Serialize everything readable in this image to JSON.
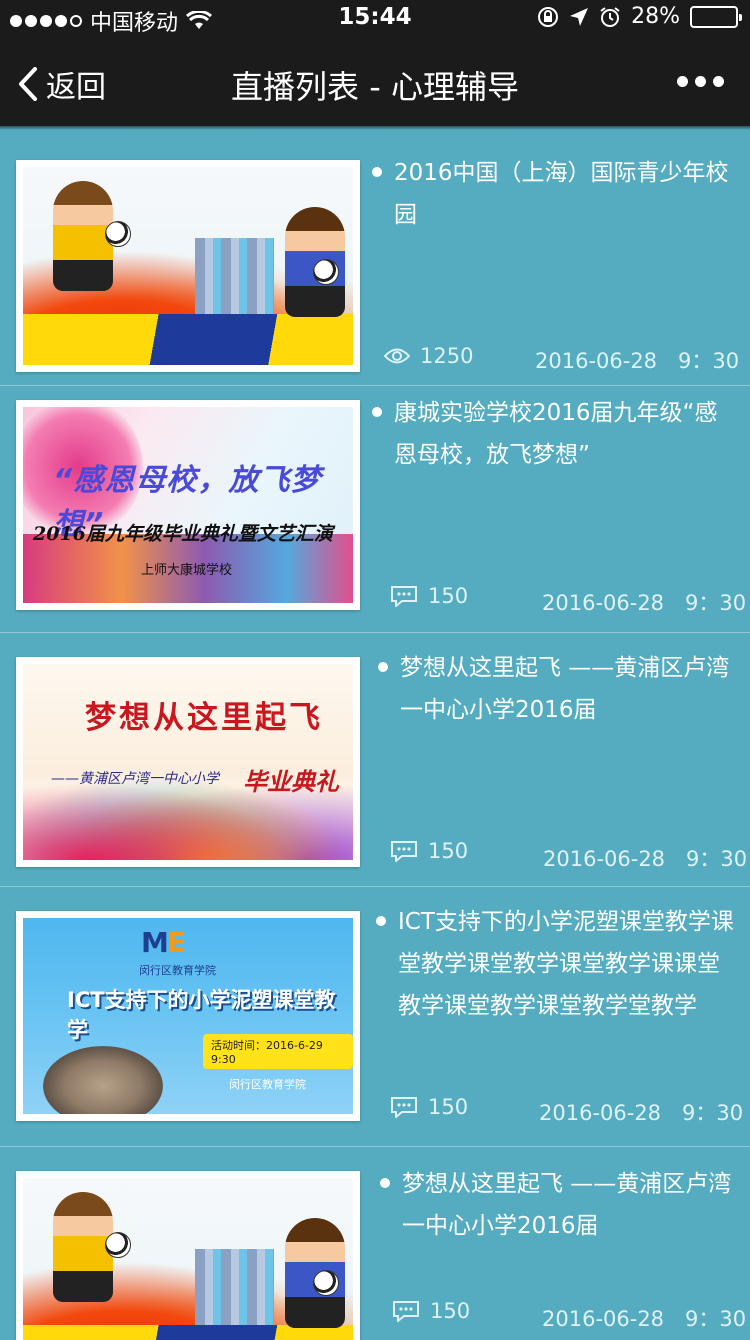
{
  "status_bar": {
    "carrier": "中国移动",
    "time": "15:44",
    "battery": "28%",
    "battery_level": 0.28
  },
  "nav": {
    "back_label": "返回",
    "title": "直播列表 - 心理辅导"
  },
  "items": [
    {
      "title": "2016中国（上海）国际青少年校园",
      "count": "1250",
      "count_icon": "eye-icon",
      "date": "2016-06-28　9：30"
    },
    {
      "title": "康城实验学校2016届九年级“感恩母校，放飞梦想”",
      "count": "150",
      "count_icon": "comment-icon",
      "date": "2016-06-28　9：30",
      "image_text": [
        "“感恩母校，放飞梦想”",
        "2016届九年级毕业典礼暨文艺汇演",
        "上师大康城学校"
      ]
    },
    {
      "title": "梦想从这里起飞 ——黄浦区卢湾一中心小学2016届",
      "count": "150",
      "count_icon": "comment-icon",
      "date": "2016-06-28　9：30",
      "image_text": [
        "梦想从这里起飞",
        "——黄浦区卢湾一中心小学",
        "毕业典礼"
      ]
    },
    {
      "title": "ICT支持下的小学泥塑课堂教学课堂教学课堂教学课堂教学课课堂教学课堂教学课堂教学堂教学",
      "count": "150",
      "count_icon": "comment-icon",
      "date": "2016-06-28　9：30",
      "image_text": [
        "闵行区教育学院",
        "ICT支持下的小学泥塑课堂教学",
        "活动时间：2016-6-29 9:30",
        "闵行区教育学院"
      ]
    },
    {
      "title": "梦想从这里起飞 ——黄浦区卢湾一中心小学2016届",
      "count": "150",
      "count_icon": "comment-icon",
      "date": "2016-06-28　9：30"
    }
  ]
}
